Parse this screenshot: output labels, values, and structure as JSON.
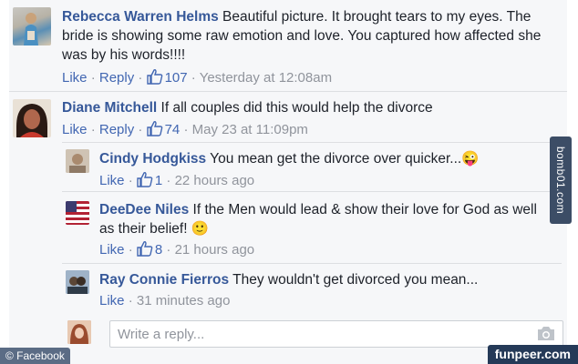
{
  "comments": [
    {
      "author": "Rebecca Warren Helms",
      "text": "Beautiful picture. It brought tears to my eyes. The bride is showing some raw emotion and love. You captured how affected she was by his words!!!!",
      "like_label": "Like",
      "reply_label": "Reply",
      "likes": "107",
      "time": "Yesterday at 12:08am"
    },
    {
      "author": "Diane Mitchell",
      "text": "If all couples did this would help the divorce",
      "like_label": "Like",
      "reply_label": "Reply",
      "likes": "74",
      "time": "May 23 at 11:09pm"
    }
  ],
  "replies": [
    {
      "author": "Cindy Hodgkiss",
      "text": "You mean get the divorce over quicker...",
      "emoji": "😜",
      "like_label": "Like",
      "likes": "1",
      "time": "22 hours ago"
    },
    {
      "author": "DeeDee Niles",
      "text": "If the Men would lead & show their love for God as well as their belief!",
      "emoji": "🙂",
      "like_label": "Like",
      "likes": "8",
      "time": "21 hours ago"
    },
    {
      "author": "Ray Connie Fierros",
      "text": "They wouldn't get divorced you mean...",
      "like_label": "Like",
      "time": "31 minutes ago"
    }
  ],
  "reply_box": {
    "placeholder": "Write a reply..."
  },
  "watermarks": {
    "facebook_credit": "© Facebook",
    "site": "funpeer.com",
    "vertical": "bomb01.com"
  },
  "colors": {
    "link": "#365899",
    "meta": "#90949c",
    "action": "#4267b2",
    "panel": "#f6f7f9"
  },
  "icons": [
    "thumbs-up-icon",
    "camera-icon"
  ]
}
